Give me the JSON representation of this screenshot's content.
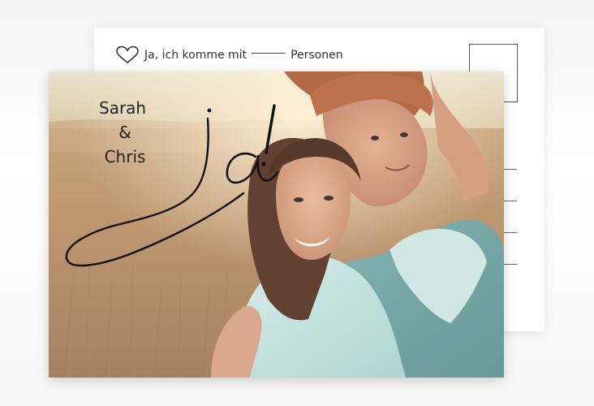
{
  "rsvp": {
    "text_before": "Ja, ich komme mit",
    "text_after": "Personen",
    "icon": "heart-outline-icon"
  },
  "couple": {
    "name1": "Sarah",
    "ampersand": "&",
    "name2": "Chris"
  },
  "headline_script": "ja!",
  "colors": {
    "background": "#f5f5f5",
    "card": "#ffffff",
    "script_ink": "#111111"
  }
}
